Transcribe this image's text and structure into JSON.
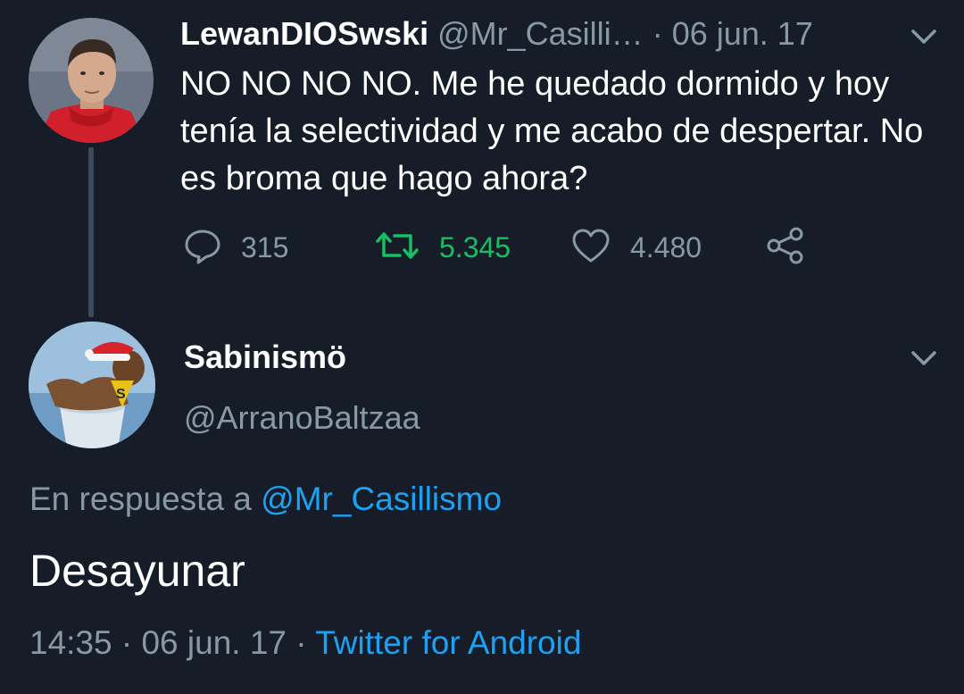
{
  "original_tweet": {
    "name": "LewanDIOSwski",
    "handle": "@Mr_Casilli…",
    "separator": "·",
    "date": "06 jun. 17",
    "text": "NO NO NO NO. Me he quedado dormido y hoy tenía la selectividad y me acabo de despertar. No es broma que hago ahora?",
    "replies": "315",
    "retweets": "5.345",
    "likes": "4.480"
  },
  "reply_tweet": {
    "name": "Sabinismö",
    "handle": "@ArranoBaltzaa",
    "reply_prefix": "En respuesta a",
    "reply_mention": "@Mr_Casillismo",
    "text": "Desayunar",
    "time": "14:35",
    "separator": "·",
    "date": "06 jun. 17",
    "separator2": "·",
    "source": "Twitter for Android"
  },
  "colors": {
    "background": "#161d28",
    "muted": "#8899a6",
    "link": "#1da1f2",
    "retweet_active": "#17bf63"
  },
  "icons": [
    "reply-icon",
    "retweet-icon",
    "like-icon",
    "share-icon",
    "chevron-down-icon"
  ]
}
